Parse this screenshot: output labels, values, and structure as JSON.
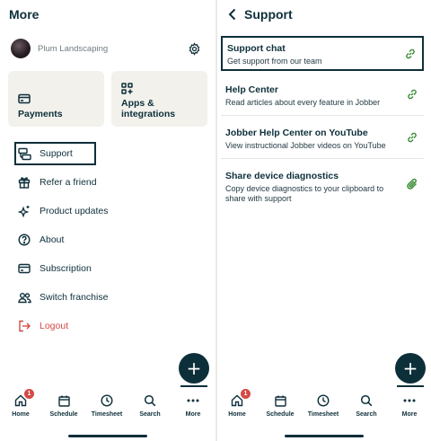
{
  "more": {
    "title": "More",
    "account_name": "Plum Landscaping",
    "cards": [
      {
        "label": "Payments",
        "icon": "payments-icon"
      },
      {
        "label": "Apps & integrations",
        "icon": "apps-icon"
      }
    ],
    "menu": [
      {
        "label": "Support",
        "icon": "support-icon"
      },
      {
        "label": "Refer a friend",
        "icon": "gift-icon"
      },
      {
        "label": "Product updates",
        "icon": "sparkle-icon"
      },
      {
        "label": "About",
        "icon": "question-icon"
      },
      {
        "label": "Subscription",
        "icon": "card-icon"
      },
      {
        "label": "Switch franchise",
        "icon": "people-icon"
      },
      {
        "label": "Logout",
        "icon": "logout-icon"
      }
    ]
  },
  "support": {
    "title": "Support",
    "items": [
      {
        "title": "Support chat",
        "description": "Get support from our team",
        "icon": "link-icon"
      },
      {
        "title": "Help Center",
        "description": "Read articles about every feature in Jobber",
        "icon": "link-icon"
      },
      {
        "title": "Jobber Help Center on YouTube",
        "description": "View instructional Jobber videos on YouTube",
        "icon": "link-icon"
      },
      {
        "title": "Share device diagnostics",
        "description": "Copy device diagnostics to your clipboard to share with support",
        "icon": "paperclip-icon"
      }
    ]
  },
  "fab_symbol": "+",
  "tabbar": {
    "tabs": [
      {
        "label": "Home",
        "icon": "home-icon",
        "badge": "1"
      },
      {
        "label": "Schedule",
        "icon": "calendar-icon"
      },
      {
        "label": "Timesheet",
        "icon": "clock-icon"
      },
      {
        "label": "Search",
        "icon": "search-icon"
      },
      {
        "label": "More",
        "icon": "more-icon"
      }
    ]
  },
  "colors": {
    "brand_dark": "#0d2f3a",
    "danger": "#d44a44",
    "link_green": "#3f8f3a",
    "card_bg": "#f2f1ec"
  }
}
